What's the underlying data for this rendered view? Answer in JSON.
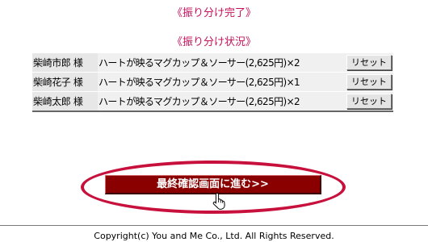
{
  "headings": {
    "complete": "《振り分け完了》",
    "status": "《振り分け状況》"
  },
  "allocations": [
    {
      "name": "柴崎市郎 様",
      "item": "ハートが映るマグカップ＆ソーサー(2,625円)×2",
      "reset_label": "リセット"
    },
    {
      "name": "柴崎花子 様",
      "item": "ハートが映るマグカップ＆ソーサー(2,625円)×1",
      "reset_label": "リセット"
    },
    {
      "name": "柴崎太郎 様",
      "item": "ハートが映るマグカップ＆ソーサー(2,625円)×2",
      "reset_label": "リセット"
    }
  ],
  "proceed_button": {
    "label": "最終確認画面に進む>>"
  },
  "footer": {
    "copyright": "Copyright(c) You and Me Co., Ltd. All Rights Reserved."
  },
  "colors": {
    "accent": "#c8105a",
    "button_bg": "#8a0000",
    "highlight_oval": "#c8103c"
  },
  "icons": {
    "cursor": "hand-pointer-icon"
  }
}
